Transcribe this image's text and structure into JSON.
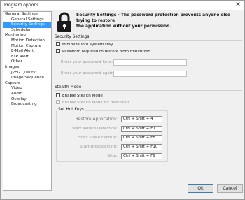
{
  "window": {
    "title": "Program options"
  },
  "tree": [
    {
      "label": "General Settings",
      "child": false,
      "selected": false
    },
    {
      "label": "General Settings",
      "child": true,
      "selected": false
    },
    {
      "label": "Security Settings",
      "child": true,
      "selected": true
    },
    {
      "label": "Scheduler",
      "child": true,
      "selected": false
    },
    {
      "label": "Monitoring",
      "child": false,
      "selected": false
    },
    {
      "label": "Motion Detection",
      "child": true,
      "selected": false
    },
    {
      "label": "Motion Capture",
      "child": true,
      "selected": false
    },
    {
      "label": "E-Mail Alert",
      "child": true,
      "selected": false
    },
    {
      "label": "FTP Alert",
      "child": true,
      "selected": false
    },
    {
      "label": "Other",
      "child": true,
      "selected": false
    },
    {
      "label": "Images",
      "child": false,
      "selected": false
    },
    {
      "label": "JPEG Quality",
      "child": true,
      "selected": false
    },
    {
      "label": "Image Sequence",
      "child": true,
      "selected": false
    },
    {
      "label": "Capture",
      "child": false,
      "selected": false
    },
    {
      "label": "Video",
      "child": true,
      "selected": false
    },
    {
      "label": "Audio",
      "child": true,
      "selected": false
    },
    {
      "label": "Overlay",
      "child": true,
      "selected": false
    },
    {
      "label": "Broadcasting",
      "child": true,
      "selected": false
    }
  ],
  "header": {
    "line1": "Security Settings - The password protection prevents anyone else trying to restore",
    "line2": "the application without your permission.",
    "icon": "padlock-icon"
  },
  "security": {
    "title": "Security Settings",
    "minimize_tray": "Minimize into system tray",
    "password_required": "Password required to restore from minimized",
    "password_label": "Enter your password here:",
    "password_again_label": "Enter your password again:",
    "password_value": "",
    "password_again_value": ""
  },
  "stealth": {
    "title": "Stealth Mode",
    "enable": "Enable Stealth Mode",
    "enable_next": "Enable Stealth Mode for next start",
    "hotkeys_title": "Set Hot Keys",
    "hotkeys": [
      {
        "label": "Restore Application:",
        "value": "Ctrl + Shift + 4"
      },
      {
        "label": "Start Motion Detection:",
        "value": "Ctrl + Shift + F7"
      },
      {
        "label": "Start Video capture:",
        "value": "Ctrl + Shift + F8"
      },
      {
        "label": "Start Broadcasting:",
        "value": "Ctrl + Shift + F10"
      },
      {
        "label": "Stop:",
        "value": "Ctrl + Shift + F9"
      }
    ]
  },
  "buttons": {
    "ok": "Ok",
    "cancel": "Cancel"
  }
}
